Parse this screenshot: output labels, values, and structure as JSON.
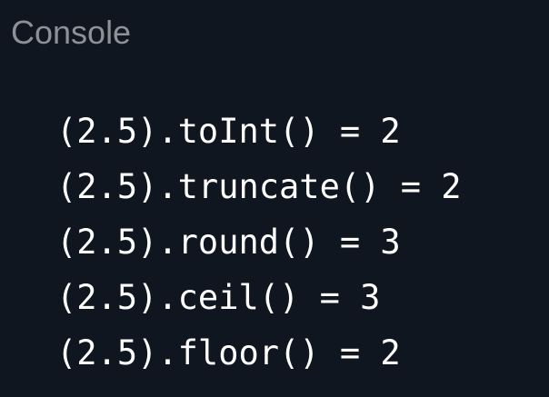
{
  "header": {
    "title": "Console"
  },
  "console": {
    "lines": [
      "(2.5).toInt() = 2",
      "(2.5).truncate() = 2",
      "(2.5).round() = 3",
      "(2.5).ceil() = 3",
      "(2.5).floor() = 2"
    ]
  }
}
